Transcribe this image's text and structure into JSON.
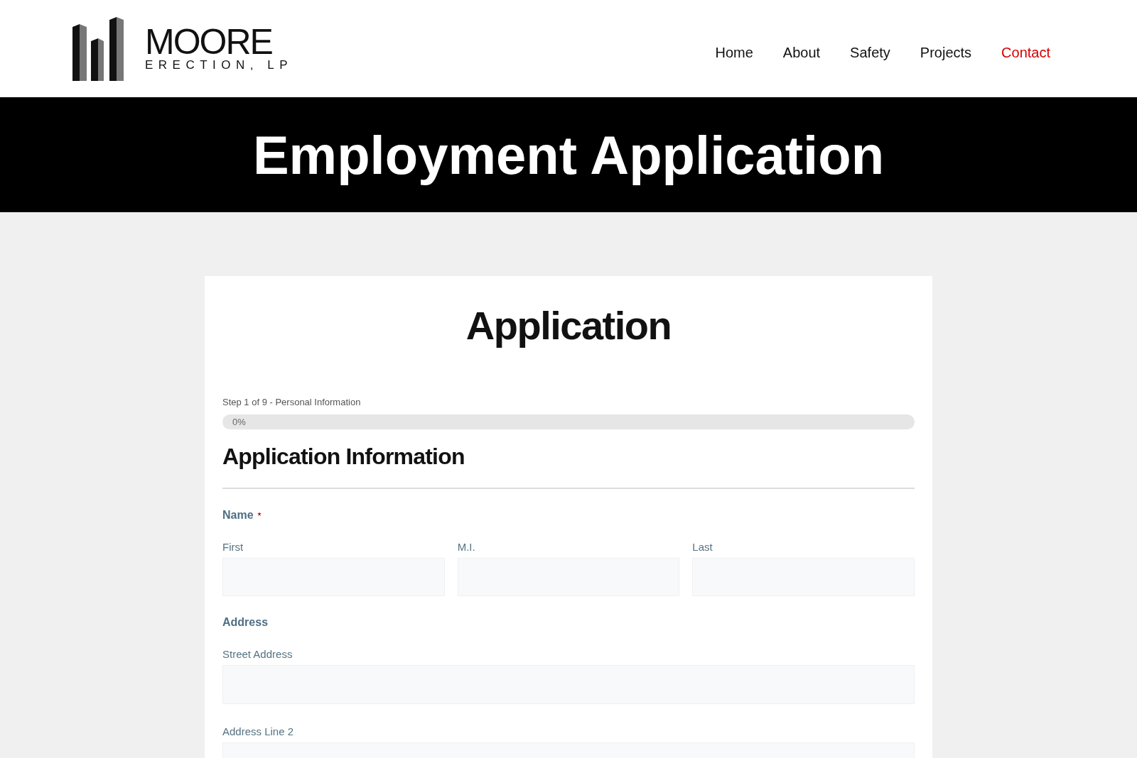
{
  "header": {
    "logo": {
      "name": "MOORE",
      "subtitle": "ERECTION, LP"
    },
    "nav": [
      {
        "label": "Home",
        "selected": false
      },
      {
        "label": "About",
        "selected": false
      },
      {
        "label": "Safety",
        "selected": false
      },
      {
        "label": "Projects",
        "selected": false
      },
      {
        "label": "Contact",
        "selected": true
      }
    ]
  },
  "banner": {
    "title": "Employment Application"
  },
  "form": {
    "title": "Application",
    "step": "Step 1 of 9 - Personal Information",
    "progress": {
      "label": "0%",
      "level": 0
    },
    "section_title": "Application Information",
    "groups": [
      {
        "label": "Name",
        "required": true,
        "kind": "row",
        "fields": [
          {
            "label": "First"
          },
          {
            "label": "M.I."
          },
          {
            "label": "Last"
          }
        ]
      },
      {
        "label": "Address",
        "required": false,
        "kind": "stack",
        "fields": [
          {
            "label": "Street Address"
          },
          {
            "label": "Address Line 2"
          }
        ]
      }
    ]
  }
}
